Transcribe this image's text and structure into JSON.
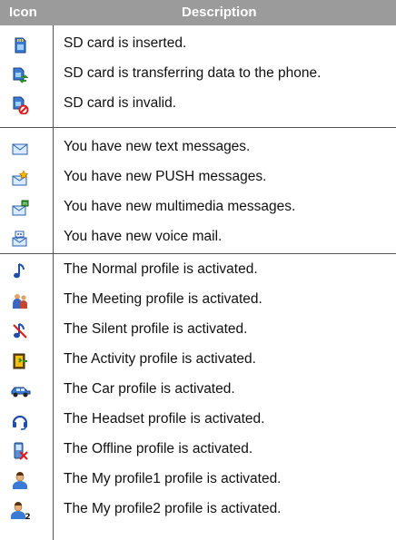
{
  "header": {
    "icon_label": "Icon",
    "description_label": "Description"
  },
  "groups": [
    {
      "rows": [
        {
          "icon": "sd-card-inserted-icon",
          "text": "SD card is inserted."
        },
        {
          "icon": "sd-card-transfer-icon",
          "text": "SD card is transferring data to the phone."
        },
        {
          "icon": "sd-card-invalid-icon",
          "text": "SD card is invalid."
        }
      ]
    },
    {
      "rows": [
        {
          "icon": "text-message-icon",
          "text": "You have new text messages."
        },
        {
          "icon": "push-message-icon",
          "text": "You have new PUSH messages."
        },
        {
          "icon": "multimedia-message-icon",
          "text": "You have new multimedia messages."
        },
        {
          "icon": "voice-mail-icon",
          "text": "You have new voice mail."
        }
      ]
    },
    {
      "rows": [
        {
          "icon": "normal-profile-icon",
          "text": "The Normal profile is activated."
        },
        {
          "icon": "meeting-profile-icon",
          "text": "The Meeting profile is activated."
        },
        {
          "icon": "silent-profile-icon",
          "text": "The Silent profile is activated."
        },
        {
          "icon": "activity-profile-icon",
          "text": "The Activity profile is activated."
        },
        {
          "icon": "car-profile-icon",
          "text": "The Car profile is activated."
        },
        {
          "icon": "headset-profile-icon",
          "text": "The Headset profile is activated."
        },
        {
          "icon": "offline-profile-icon",
          "text": "The Offline profile is activated."
        },
        {
          "icon": "my-profile1-icon",
          "text": "The My profile1 profile is activated."
        },
        {
          "icon": "my-profile2-icon",
          "text": "The My profile2 profile is activated."
        }
      ]
    }
  ]
}
